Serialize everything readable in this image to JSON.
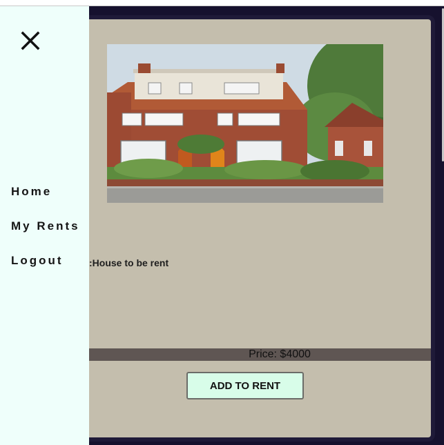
{
  "sidebar": {
    "close_icon": "close-icon",
    "items": [
      {
        "label": "Home"
      },
      {
        "label": "My Rents"
      },
      {
        "label": "Logout"
      }
    ]
  },
  "listing": {
    "image_alt": "House to be rent",
    "title": ":House to be rent",
    "price": "Price: $4000",
    "button_label": "ADD TO RENT"
  },
  "colors": {
    "sidebar_bg": "#effffb",
    "card_bg": "#c4bead",
    "backdrop": "#16112e",
    "price_bar": "#5f5653",
    "button_bg": "#d8fde9"
  }
}
